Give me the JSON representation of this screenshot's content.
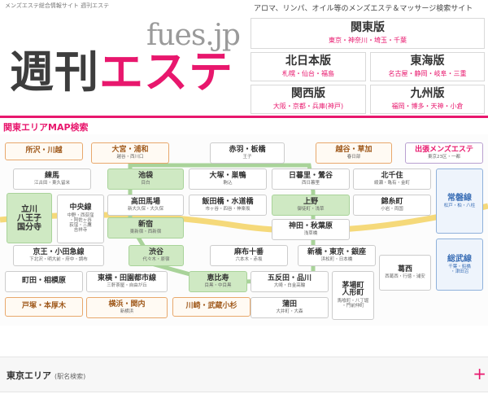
{
  "header": {
    "site_tag": "メンズエステ総合情報サイト 週刊エステ",
    "description": "アロマ、リンパ、オイル等のメンズエステ＆マッサージ検索サイト",
    "logo_domain": "fues.jp",
    "logo_kanji": "週刊",
    "logo_kana": "エステ"
  },
  "regions": {
    "kanto": {
      "name": "関東版",
      "areas": "東京・神奈川・埼玉・千葉"
    },
    "kitanihon": {
      "name": "北日本版",
      "areas": "札幌・仙台・福島"
    },
    "tokai": {
      "name": "東海版",
      "areas": "名古屋・静岡・岐阜・三重"
    },
    "kansai": {
      "name": "関西版",
      "areas": "大阪・京都・兵庫(神戸)"
    },
    "kyushu": {
      "name": "九州版",
      "areas": "福岡・博多・天神・小倉"
    }
  },
  "map_title": "関東エリアMAP検索",
  "stations": {
    "tokorozawa": {
      "name": "所沢・川越"
    },
    "omiya": {
      "name": "大宮・浦和",
      "sub": "越谷・西川口"
    },
    "akabane": {
      "name": "赤羽・板橋",
      "sub": "王子"
    },
    "koshigaya": {
      "name": "越谷・草加",
      "sub": "春日部"
    },
    "shucchou": {
      "name": "出張メンズエステ",
      "sub": "東京23区・一都"
    },
    "nerima": {
      "name": "練馬",
      "sub": "江古田・東久留米"
    },
    "ikebukuro": {
      "name": "池袋",
      "sub": "目白"
    },
    "otsuka": {
      "name": "大塚・巣鴨",
      "sub": "駒込"
    },
    "nippori": {
      "name": "日暮里・鶯谷",
      "sub": "西日暮里"
    },
    "kitasenju": {
      "name": "北千住",
      "sub": "綾瀬・亀有・金町"
    },
    "tachikawa": {
      "name": "立川\n八王子\n国分寺"
    },
    "chuosen": {
      "name": "中央線",
      "sub": "中野・西荻窪\n・阿佐ヶ谷\n荻窪・三鷹\n吉祥寺"
    },
    "takadanobaba": {
      "name": "高田馬場",
      "sub": "新大久保・大久保"
    },
    "iidabashi": {
      "name": "飯田橋・水道橋",
      "sub": "市ヶ谷・四谷・神楽坂"
    },
    "ueno": {
      "name": "上野",
      "sub": "御徒町・浅草"
    },
    "kinshicho": {
      "name": "錦糸町",
      "sub": "小岩・両国"
    },
    "joban": {
      "name": "常磐線",
      "sub": "松戸・柏・八柱"
    },
    "shinjuku": {
      "name": "新宿",
      "sub": "東新宿・西新宿"
    },
    "kanda": {
      "name": "神田・秋葉原",
      "sub": "浅草橋"
    },
    "keio": {
      "name": "京王・小田急線",
      "sub": "下北沢・明大前・府中・調布"
    },
    "shibuya": {
      "name": "渋谷",
      "sub": "代々木・原宿"
    },
    "azabu": {
      "name": "麻布十番",
      "sub": "六本木・赤坂"
    },
    "shinbashi": {
      "name": "新橋・東京・銀座",
      "sub": "浜松町・日本橋"
    },
    "kasai": {
      "name": "葛西",
      "sub": "西葛西・行徳・浦安"
    },
    "sobu": {
      "name": "総武線",
      "sub": "千葉・船橋\n・津田沼"
    },
    "machida": {
      "name": "町田・相模原"
    },
    "toyoko": {
      "name": "東横・田園都市線",
      "sub": "三軒茶屋・自由が丘"
    },
    "ebisu": {
      "name": "恵比寿",
      "sub": "目黒・中目黒"
    },
    "gotanda": {
      "name": "五反田・品川",
      "sub": "大崎・白金高輪"
    },
    "kayabacho": {
      "name": "茅場町\n人形町",
      "sub": "馬喰町・八丁堀\n・門前仲町"
    },
    "totsuka": {
      "name": "戸塚・本厚木"
    },
    "yokohama": {
      "name": "横浜・関内",
      "sub": "新横浜"
    },
    "kawasaki": {
      "name": "川崎・武蔵小杉"
    },
    "kamata": {
      "name": "蒲田",
      "sub": "大井町・大森"
    }
  },
  "accordion": {
    "title": "東京エリア",
    "subtitle": "(駅名検索)",
    "toggle": "+"
  },
  "colors": {
    "accent": "#e8176d",
    "yamanote": "#a9d39a",
    "chuo": "#f5d97a",
    "line_blue": "#8fb1db"
  }
}
